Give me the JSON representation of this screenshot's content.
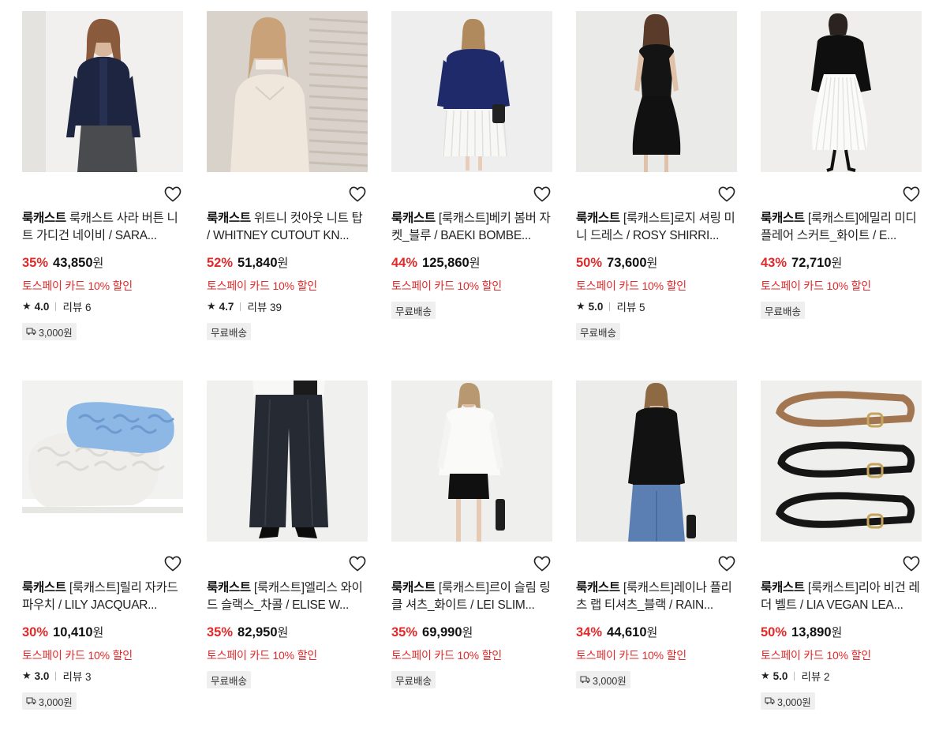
{
  "products": [
    {
      "brand": "룩캐스트",
      "name": "룩캐스트 사라 버튼 니트 가디건 네이비 / SARA...",
      "discount": "35%",
      "price": "43,850",
      "currency": "원",
      "promo": "토스페이 카드 10% 할인",
      "rating": "4.0",
      "reviews": "리뷰 6",
      "shipping": "3,000원",
      "shipping_type": "paid",
      "image": "woman-navy-cardigan"
    },
    {
      "brand": "룩캐스트",
      "name": "위트니 컷아웃 니트 탑 / WHITNEY CUTOUT KN...",
      "discount": "52%",
      "price": "51,840",
      "currency": "원",
      "promo": "토스페이 카드 10% 할인",
      "rating": "4.7",
      "reviews": "리뷰 39",
      "shipping": "무료배송",
      "shipping_type": "free",
      "image": "woman-cream-knit"
    },
    {
      "brand": "룩캐스트",
      "name": "[룩캐스트]베키 봄버 자켓_블루 / BAEKI BOMBE...",
      "discount": "44%",
      "price": "125,860",
      "currency": "원",
      "promo": "토스페이 카드 10% 할인",
      "rating": null,
      "reviews": null,
      "shipping": "무료배송",
      "shipping_type": "free",
      "image": "woman-blue-bomber"
    },
    {
      "brand": "룩캐스트",
      "name": "[룩캐스트]로지 셔링 미니 드레스 / ROSY SHIRRI...",
      "discount": "50%",
      "price": "73,600",
      "currency": "원",
      "promo": "토스페이 카드 10% 할인",
      "rating": "5.0",
      "reviews": "리뷰 5",
      "shipping": "무료배송",
      "shipping_type": "free",
      "image": "woman-black-dress"
    },
    {
      "brand": "룩캐스트",
      "name": "[룩캐스트]에밀리 미디 플레어 스커트_화이트 / E...",
      "discount": "43%",
      "price": "72,710",
      "currency": "원",
      "promo": "토스페이 카드 10% 할인",
      "rating": null,
      "reviews": null,
      "shipping": "무료배송",
      "shipping_type": "free",
      "image": "woman-white-skirt"
    },
    {
      "brand": "룩캐스트",
      "name": "[룩캐스트]릴리 자카드 파우치 / LILY JACQUAR...",
      "discount": "30%",
      "price": "10,410",
      "currency": "원",
      "promo": "토스페이 카드 10% 할인",
      "rating": "3.0",
      "reviews": "리뷰 3",
      "shipping": "3,000원",
      "shipping_type": "paid",
      "image": "blue-white-pouches"
    },
    {
      "brand": "룩캐스트",
      "name": "[룩캐스트]엘리스 와이드 슬랙스_차콜 / ELISE W...",
      "discount": "35%",
      "price": "82,950",
      "currency": "원",
      "promo": "토스페이 카드 10% 할인",
      "rating": null,
      "reviews": null,
      "shipping": "무료배송",
      "shipping_type": "free",
      "image": "charcoal-wide-slacks"
    },
    {
      "brand": "룩캐스트",
      "name": "[룩캐스트]르이 슬림 링클 셔츠_화이트 / LEI SLIM...",
      "discount": "35%",
      "price": "69,990",
      "currency": "원",
      "promo": "토스페이 카드 10% 할인",
      "rating": null,
      "reviews": null,
      "shipping": "무료배송",
      "shipping_type": "free",
      "image": "woman-white-shirt"
    },
    {
      "brand": "룩캐스트",
      "name": "[룩캐스트]레이나 플리츠 랩 티셔츠_블랙 / RAIN...",
      "discount": "34%",
      "price": "44,610",
      "currency": "원",
      "promo": "토스페이 카드 10% 할인",
      "rating": null,
      "reviews": null,
      "shipping": "3,000원",
      "shipping_type": "paid",
      "image": "woman-black-wrap-top"
    },
    {
      "brand": "룩캐스트",
      "name": "[룩캐스트]리아 비건 레더 벨트 / LIA VEGAN LEA...",
      "discount": "50%",
      "price": "13,890",
      "currency": "원",
      "promo": "토스페이 카드 10% 할인",
      "rating": "5.0",
      "reviews": "리뷰 2",
      "shipping": "3,000원",
      "shipping_type": "paid",
      "image": "three-leather-belts"
    }
  ],
  "colors": {
    "discount": "#e2292a",
    "promo": "#e2292a",
    "tag_bg": "#efefef",
    "thumb_bg": "#ededed"
  },
  "icons": {
    "wishlist": "heart-outline-icon",
    "rating": "star-icon",
    "shipping": "truck-icon"
  }
}
